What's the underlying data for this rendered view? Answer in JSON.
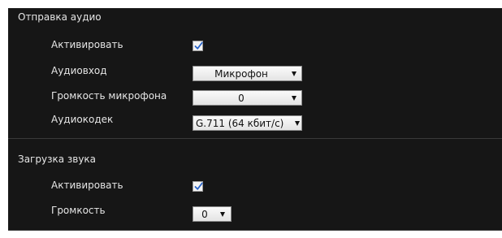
{
  "audio_send": {
    "title": "Отправка аудио",
    "activate_label": "Активировать",
    "activate_checked": true,
    "input_label": "Аудиовход",
    "input_value": "Микрофон",
    "mic_volume_label": "Громкость микрофона",
    "mic_volume_value": "0",
    "codec_label": "Аудиокодек",
    "codec_value": "G.711 (64 кбит/с)"
  },
  "audio_upload": {
    "title": "Загрузка звука",
    "activate_label": "Активировать",
    "activate_checked": true,
    "volume_label": "Громкость",
    "volume_value": "0"
  },
  "colors": {
    "panel_bg": "#161616",
    "checkmark": "#2a64c8"
  },
  "icons": {
    "checkbox": "checkmark-icon",
    "dropdown": "triangle-down-icon"
  }
}
